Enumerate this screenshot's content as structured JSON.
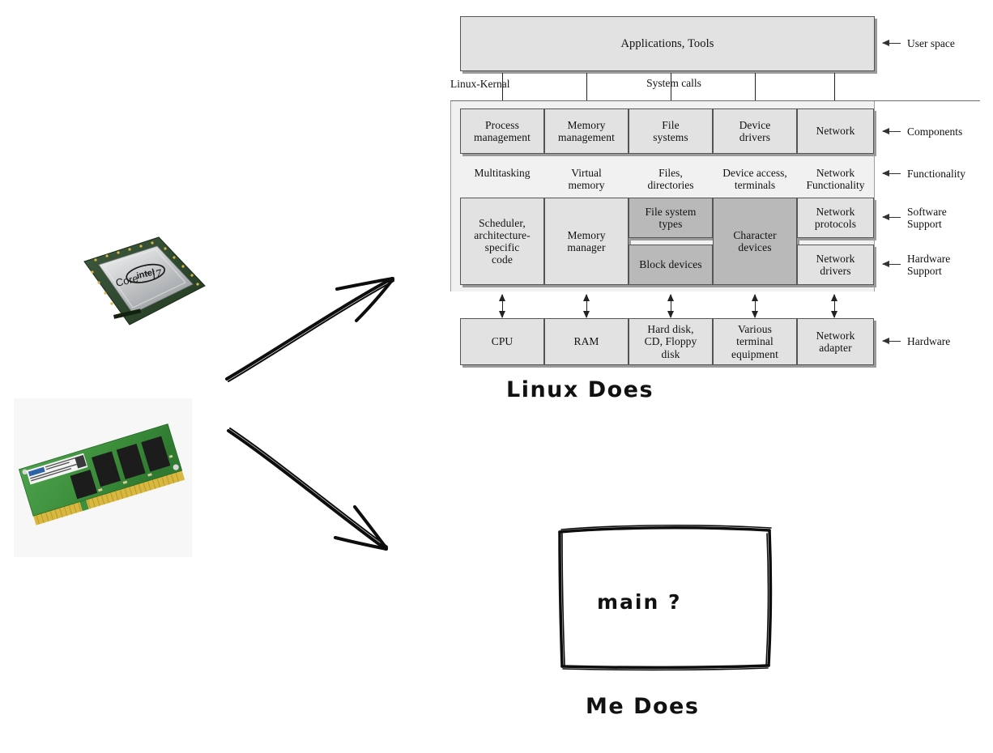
{
  "title": "Linux kernel architecture vs. main()",
  "photos": {
    "cpu": {
      "name": "intel-core-i7-cpu",
      "brand": "intel",
      "model": "Core™ i7"
    },
    "ram": {
      "name": "ddr-ram-module"
    }
  },
  "arrows": [
    {
      "name": "arrow-cpu-to-linux-diagram",
      "direction": "up-right"
    },
    {
      "name": "arrow-ram-to-main-box",
      "direction": "down-right"
    }
  ],
  "diagram": {
    "userspace_box": "Applications, Tools",
    "syscalls_label": "System calls",
    "kernel_rule_label": "Linux-Kernal",
    "components": [
      "Process\nmanagement",
      "Memory\nmanagement",
      "File\nsystems",
      "Device\ndrivers",
      "Network"
    ],
    "functionality": [
      "Multitasking",
      "Virtual\nmemory",
      "Files,\ndirectories",
      "Device access,\nterminals",
      "Network\nFunctionality"
    ],
    "support": [
      {
        "label": "Scheduler,\narchitecture-\nspecific\ncode",
        "shade": "light"
      },
      {
        "label": "Memory\nmanager",
        "shade": "light"
      },
      {
        "label": "File system\ntypes",
        "shade": "dark"
      },
      {
        "label": "Block devices",
        "shade": "dark"
      },
      {
        "label": "Character\ndevices",
        "shade": "dark"
      },
      {
        "label": "Network\nprotocols",
        "shade": "light"
      },
      {
        "label": "Network\ndrivers",
        "shade": "light"
      }
    ],
    "hardware": [
      "CPU",
      "RAM",
      "Hard disk,\nCD, Floppy\ndisk",
      "Various\nterminal\nequipment",
      "Network\nadapter"
    ],
    "side_labels": [
      "User space",
      "Components",
      "Functionality",
      "Software\nSupport",
      "Hardware\nSupport",
      "Hardware"
    ]
  },
  "captions": {
    "linux_does": "Linux Does",
    "me_does": "Me Does",
    "main_question": "main ?"
  },
  "colors": {
    "box_light": "#e2e2e2",
    "box_dark": "#b9b9b9",
    "kernel_panel": "#f1f1f1",
    "ink": "#111111",
    "shadow": "#9a9a9a"
  }
}
